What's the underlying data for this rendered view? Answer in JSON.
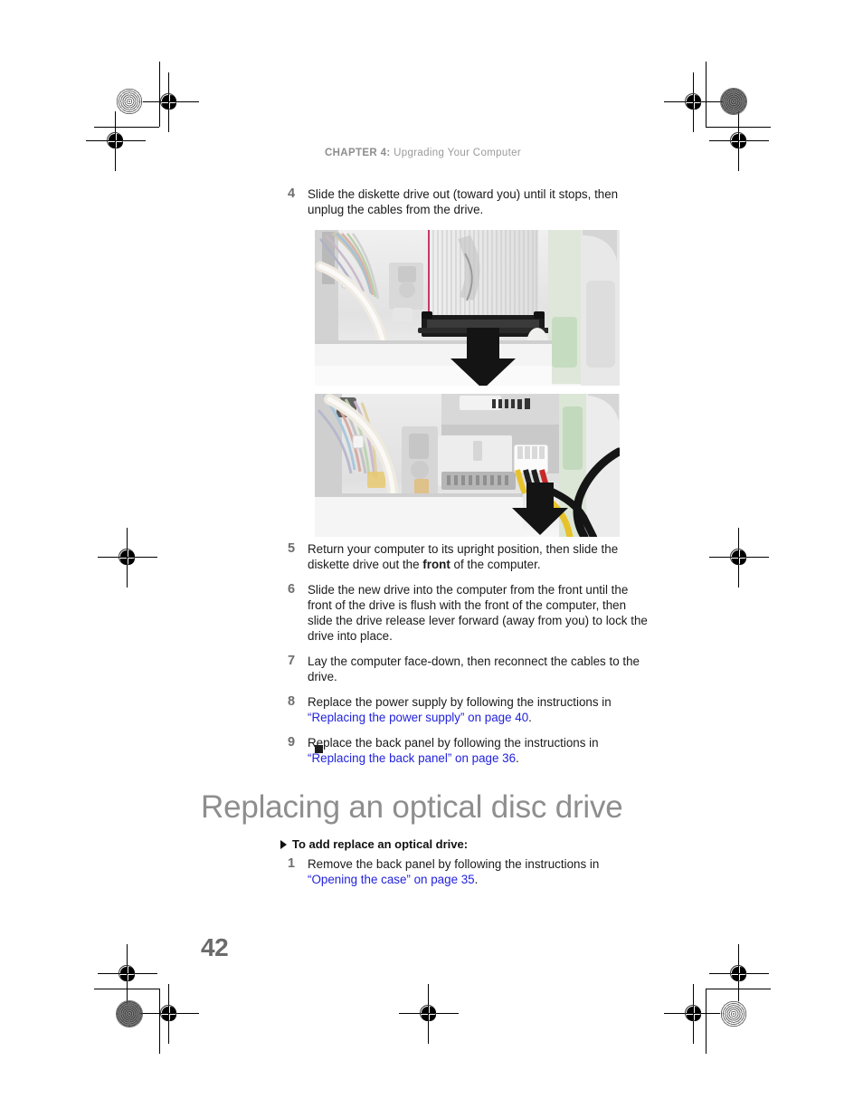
{
  "document": {
    "running_head": "CHAPTER 4: Upgrading Your Computer",
    "running_head_chapter": "CHAPTER 4:",
    "running_head_title": "Upgrading Your Computer",
    "page_number": "42",
    "header_color": "#9a9a9a",
    "link_color": "#2222dd",
    "heading_color": "#8e8e8e",
    "body_color": "#1a1a1a"
  },
  "steps_top": [
    {
      "number": "4",
      "text": "Slide the diskette drive out (toward you) until it stops, then unplug the cables from the drive."
    }
  ],
  "figures": [
    {
      "name": "diskette-drive-ribbon-cable-photo",
      "caption": "Photo of diskette drive ribbon cable connector inside computer case with downward arrow"
    },
    {
      "name": "diskette-drive-power-cable-photo",
      "caption": "Photo of diskette drive power connector with yellow, red and black wires and downward arrow"
    }
  ],
  "steps_mid": [
    {
      "number": "5",
      "parts": [
        {
          "type": "text",
          "value": "Return your computer to its upright position, then slide the diskette drive out the "
        },
        {
          "type": "bold",
          "value": "front"
        },
        {
          "type": "text",
          "value": " of the computer."
        }
      ]
    },
    {
      "number": "6",
      "parts": [
        {
          "type": "text",
          "value": "Slide the new drive into the computer from the front until the front of the drive is flush with the front of the computer, then slide the drive release lever forward (away from you) to lock the drive into place."
        }
      ]
    },
    {
      "number": "7",
      "parts": [
        {
          "type": "text",
          "value": "Lay the computer face-down, then reconnect the cables to the drive."
        }
      ]
    },
    {
      "number": "8",
      "parts": [
        {
          "type": "text",
          "value": "Replace the power supply by following the instructions in "
        },
        {
          "type": "link",
          "value": "“Replacing the power supply” on page 40"
        },
        {
          "type": "text",
          "value": "."
        }
      ]
    },
    {
      "number": "9",
      "parts": [
        {
          "type": "text",
          "value": "Replace the back panel by following the instructions in "
        },
        {
          "type": "link",
          "value": "“Replacing the back panel” on page 36"
        },
        {
          "type": "text",
          "value": "."
        }
      ]
    }
  ],
  "section": {
    "title": "Replacing an optical disc drive",
    "procedure_heading": "To add replace an optical drive:"
  },
  "steps_bottom": [
    {
      "number": "1",
      "parts": [
        {
          "type": "text",
          "value": "Remove the back panel by following the instructions in "
        },
        {
          "type": "link",
          "value": "“Opening the case” on page 35"
        },
        {
          "type": "text",
          "value": "."
        }
      ]
    }
  ]
}
